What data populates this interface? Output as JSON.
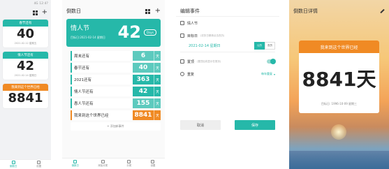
{
  "phone1": {
    "status_right": "4G 12:4?",
    "cards": [
      {
        "header": "春节还有",
        "value": "40",
        "date": "2021.02.12 星期五",
        "color": "teal"
      },
      {
        "header": "情人节还有",
        "value": "42",
        "date": "2021.02.14 星期日",
        "color": "teal"
      },
      {
        "header": "我来到这个世界已经",
        "value": "8841",
        "date": "",
        "color": "orange"
      }
    ],
    "nav": [
      "倒数日",
      "设置"
    ]
  },
  "phone2": {
    "title": "倒数日",
    "hero": {
      "title": "情人节",
      "date": "目标日:2021-02-14 星期日",
      "value": "42",
      "unit": "Days"
    },
    "rows": [
      {
        "label": "周末还有",
        "value": "6",
        "unit": "天",
        "tone": "lt"
      },
      {
        "label": "春节还有",
        "value": "40",
        "unit": "天",
        "tone": "lt"
      },
      {
        "label": "2021还有",
        "value": "363",
        "unit": "天",
        "tone": "dk"
      },
      {
        "label": "情人节还有",
        "value": "42",
        "unit": "天",
        "tone": "dk"
      },
      {
        "label": "愚人节还有",
        "value": "155",
        "unit": "天",
        "tone": "lt"
      },
      {
        "label": "我来到这个世界已经",
        "value": "8841",
        "unit": "天",
        "tone": "or"
      }
    ],
    "add_label": "+ 添加新事件",
    "nav": [
      "倒数日",
      "添加分类",
      "分类",
      "设置"
    ]
  },
  "phone3": {
    "title": "编辑事件",
    "event_name": "情人节",
    "target_date_label": "目标日",
    "target_date_hint": "(农历日期请点击农历)",
    "date_value": "2021-02-14 星期日",
    "seg": [
      "公历",
      "农历"
    ],
    "pin_label": "置顶",
    "pin_hint": "(置顶后将显示在首页)",
    "repeat_label": "重复",
    "repeat_value": "每年重复",
    "cancel": "取消",
    "save": "保存"
  },
  "phone4": {
    "title": "倒数日详情",
    "header": "我来到这个世界已经",
    "value": "8841天",
    "target": "目标日: 1996-10-09 星期三"
  }
}
